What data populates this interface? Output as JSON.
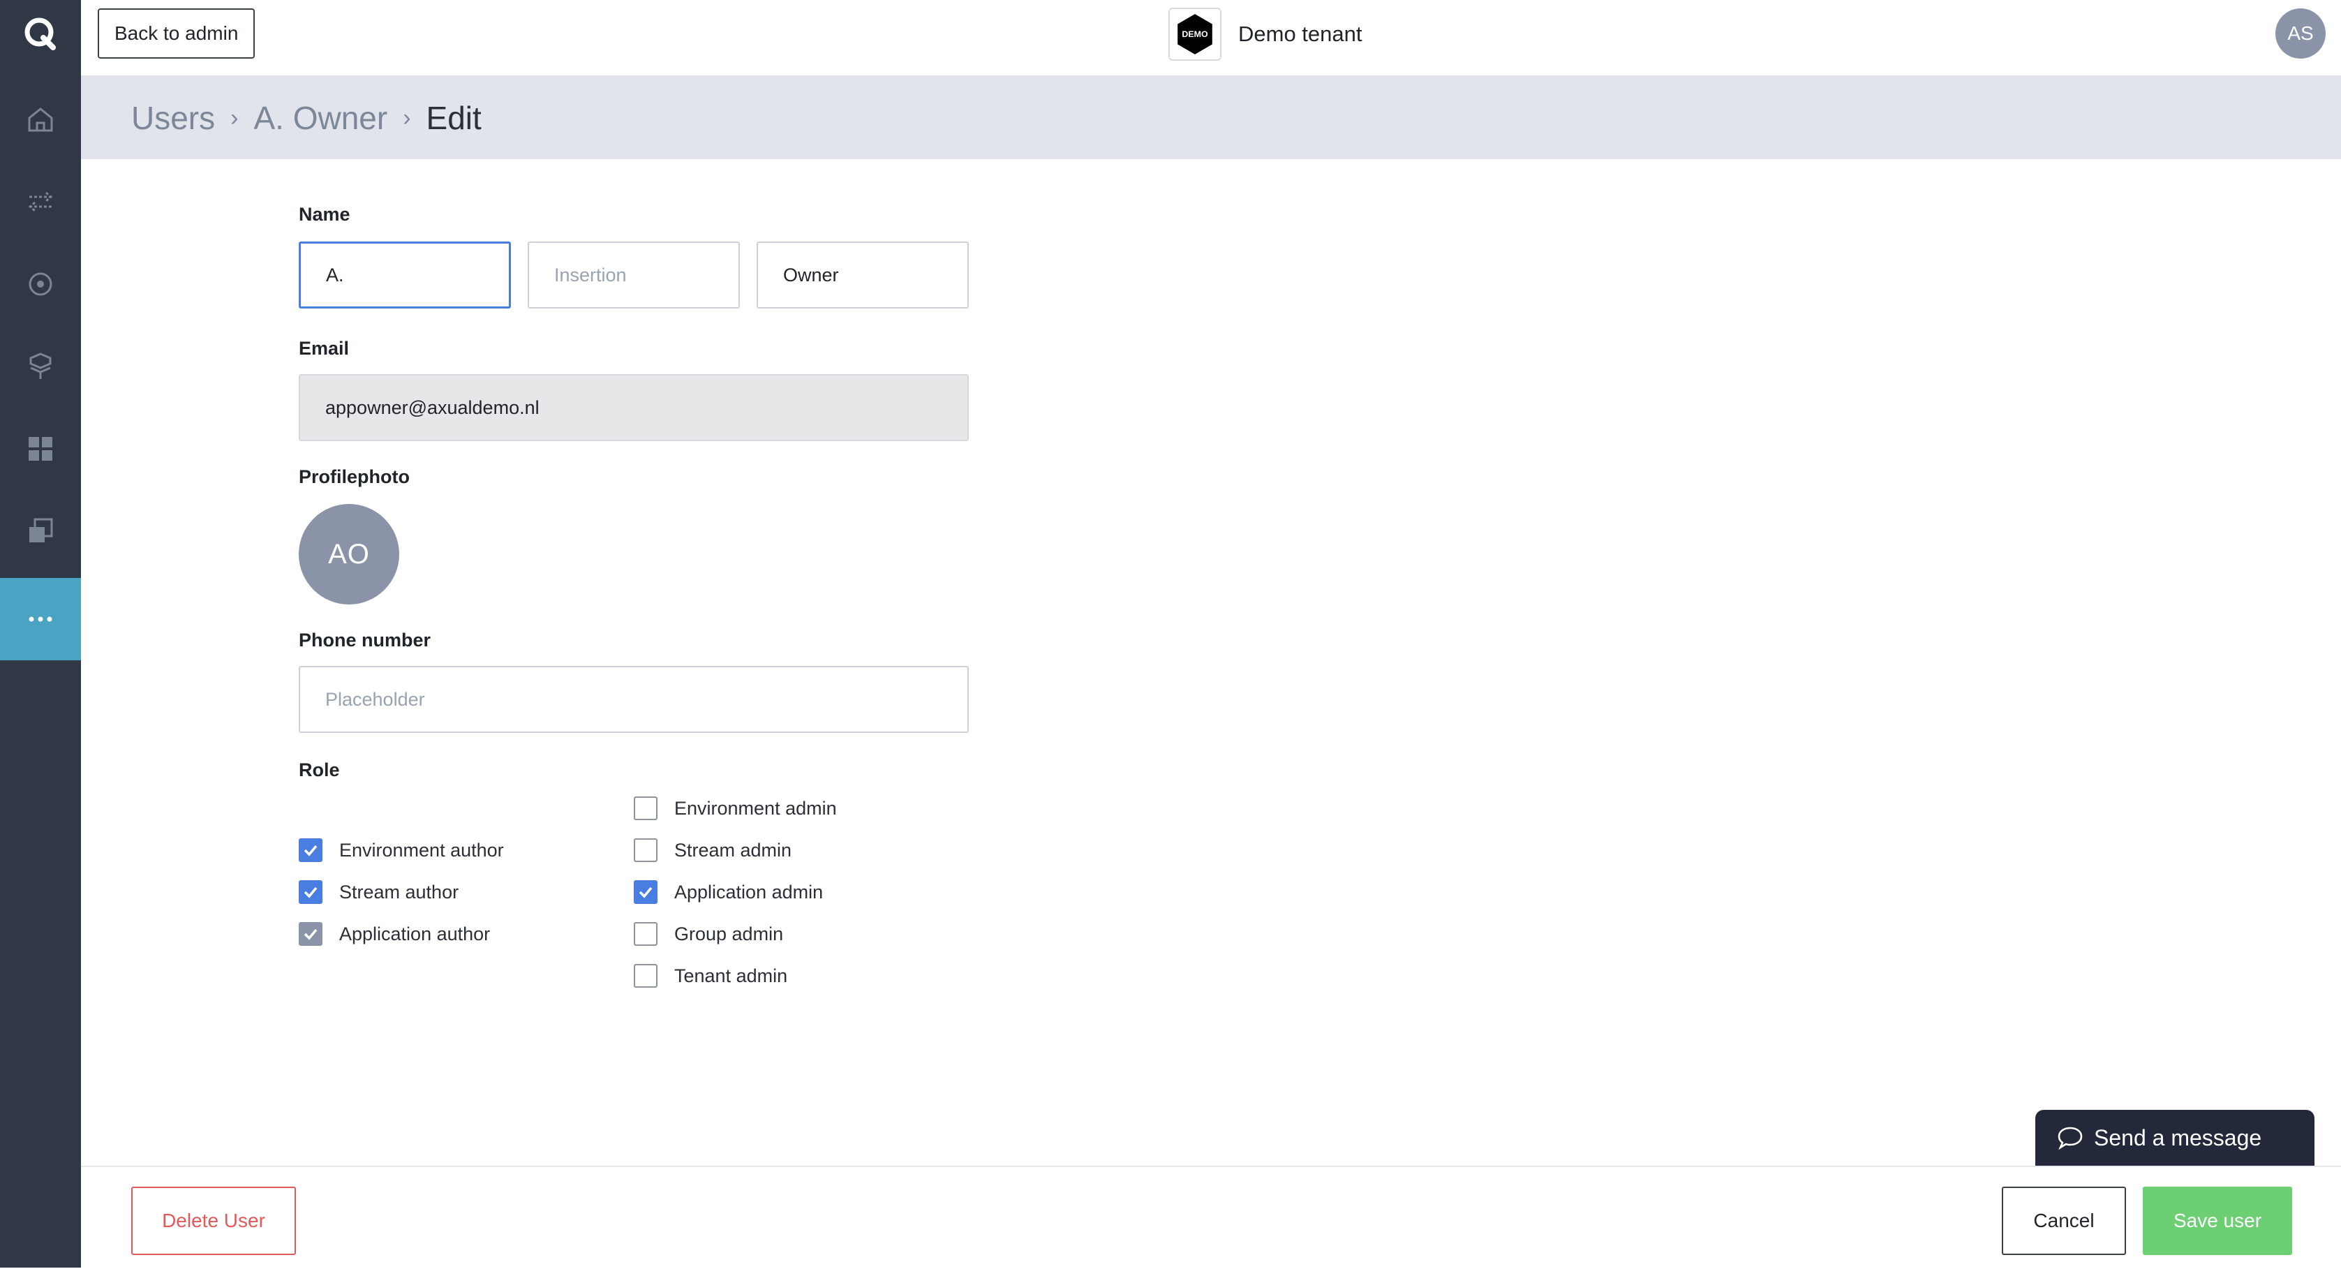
{
  "topbar": {
    "back_label": "Back to admin",
    "tenant_logo_text": "DEMO",
    "tenant_name": "Demo tenant",
    "user_initials": "AS"
  },
  "breadcrumb": {
    "items": [
      "Users",
      "A. Owner",
      "Edit"
    ]
  },
  "form": {
    "name_label": "Name",
    "first_name_value": "A.",
    "insertion_placeholder": "Insertion",
    "last_name_value": "Owner",
    "email_label": "Email",
    "email_value": "appowner@axualdemo.nl",
    "profile_label": "Profilephoto",
    "profile_initials": "AO",
    "phone_label": "Phone number",
    "phone_placeholder": "Placeholder",
    "role_label": "Role",
    "roles_left": [
      {
        "label": "Environment author",
        "checked": true
      },
      {
        "label": "Stream author",
        "checked": true
      },
      {
        "label": "Application author",
        "checked": true
      }
    ],
    "roles_right": [
      {
        "label": "Environment admin",
        "checked": false
      },
      {
        "label": "Stream admin",
        "checked": false
      },
      {
        "label": "Application admin",
        "checked": true
      },
      {
        "label": "Group admin",
        "checked": false
      },
      {
        "label": "Tenant admin",
        "checked": false
      }
    ]
  },
  "footer": {
    "delete_label": "Delete User",
    "cancel_label": "Cancel",
    "save_label": "Save user"
  },
  "chat": {
    "label": "Send a message"
  },
  "sidebar": {
    "icons": [
      "logo-icon",
      "home-icon",
      "streams-icon",
      "environment-icon",
      "services-icon",
      "dashboard-icon",
      "copy-icon",
      "more-icon"
    ]
  },
  "colors": {
    "sidebar_bg": "#2f3844",
    "sidebar_active": "#4aa3c3",
    "accent_blue": "#4a7de0",
    "save_green": "#6ccf74",
    "delete_red": "#e05a5a",
    "avatar_gray": "#8a93a8"
  }
}
